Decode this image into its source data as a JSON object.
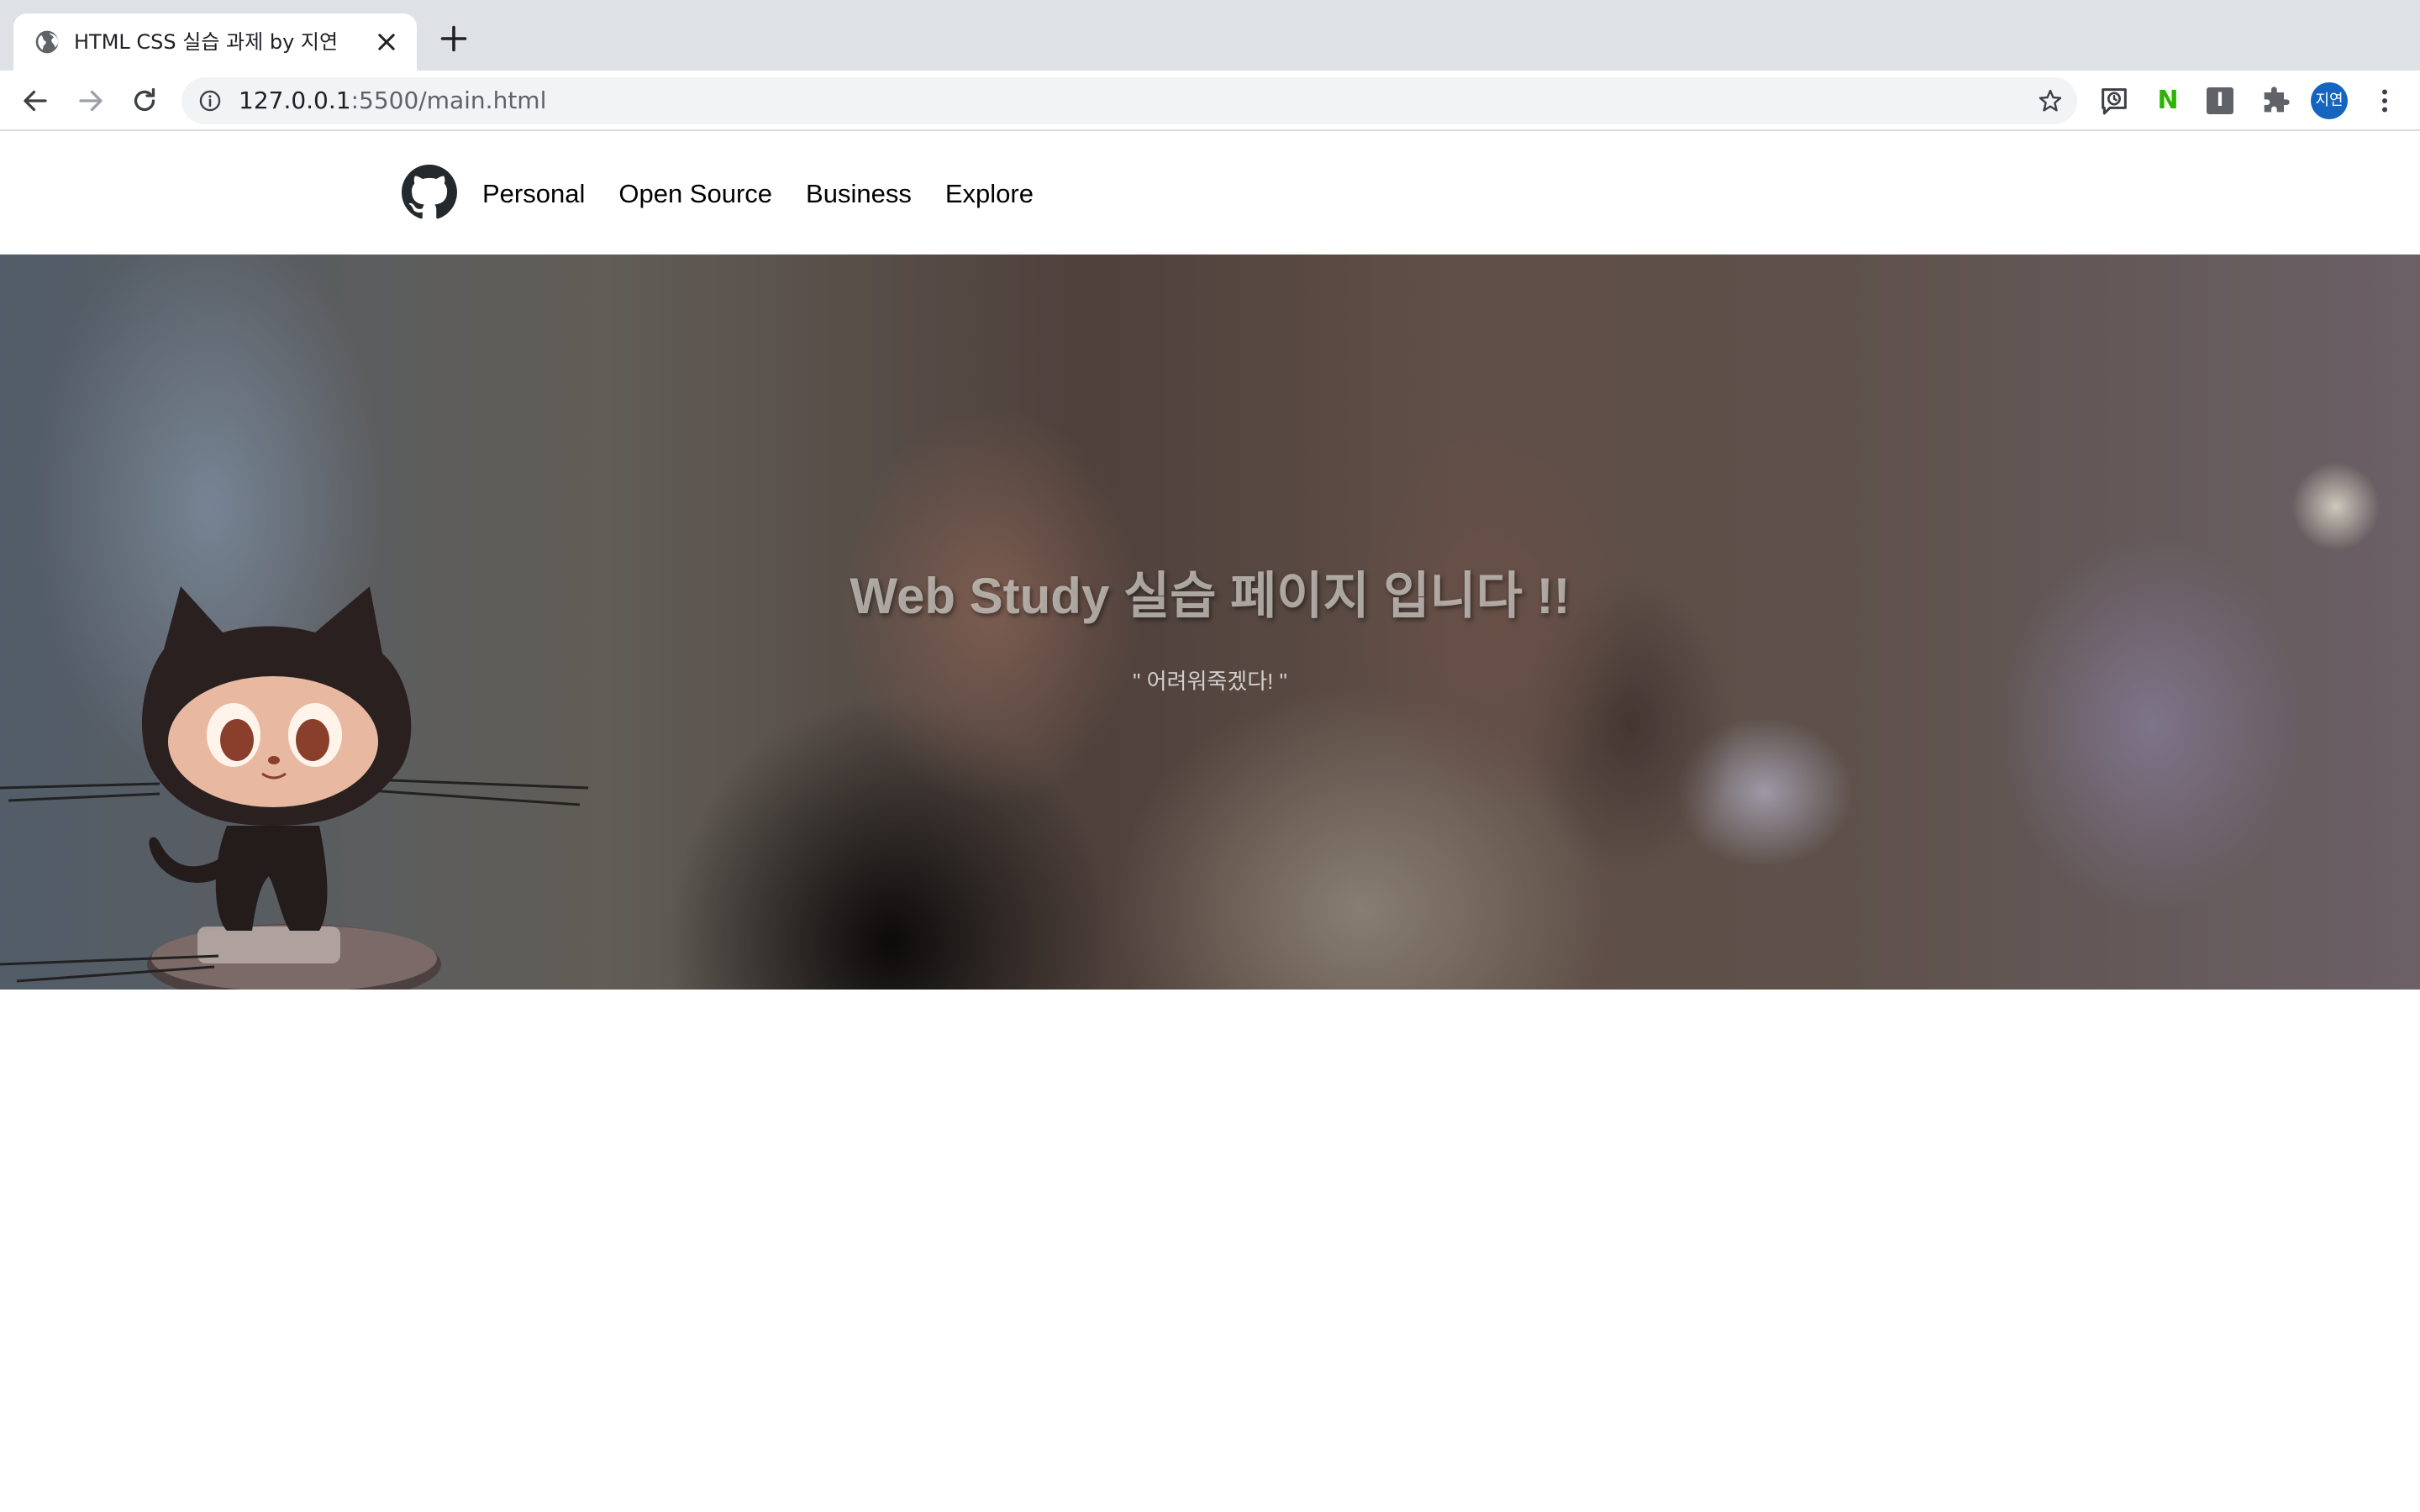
{
  "browser": {
    "tab_title": "HTML CSS 실습 과제 by 지연",
    "url_host": "127.0.0.1",
    "url_rest": ":5500/main.html",
    "extensions": {
      "n_label": "N",
      "i_label": "I"
    },
    "profile_label": "지연"
  },
  "site": {
    "nav": [
      "Personal",
      "Open Source",
      "Business",
      "Explore"
    ]
  },
  "hero": {
    "title": "Web Study 실습 페이지 입니다 !!",
    "subtitle": "\" 어려워죽겠다! \""
  },
  "colors": {
    "tabstrip": "#dee1e6",
    "omnibox": "#f1f3f4",
    "avatar": "#1565c0",
    "naver_green": "#2db400"
  }
}
